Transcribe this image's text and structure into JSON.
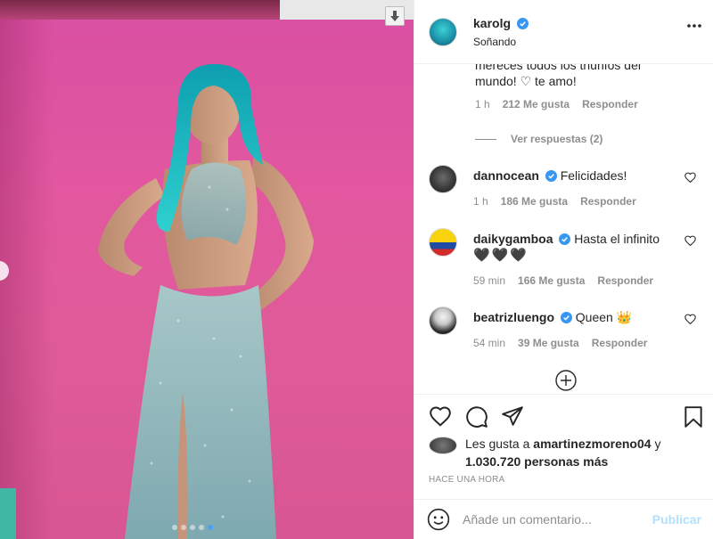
{
  "post": {
    "username": "karolg",
    "location": "Soñando"
  },
  "comments": {
    "truncated": {
      "text": "mereces todos los triunfos del mundo! ♡ te amo!",
      "time": "1 h",
      "likes": "212 Me gusta",
      "reply": "Responder"
    },
    "view_replies": "Ver respuestas (2)",
    "items": [
      {
        "username": "dannocean",
        "text": "Felicidades!",
        "time": "1 h",
        "likes": "186 Me gusta",
        "reply": "Responder"
      },
      {
        "username": "daikygamboa",
        "text": "Hasta el infinito",
        "extra": "🖤🖤🖤",
        "time": "59 min",
        "likes": "166 Me gusta",
        "reply": "Responder"
      },
      {
        "username": "beatrizluengo",
        "text": "Queen 👑",
        "time": "54 min",
        "likes": "39 Me gusta",
        "reply": "Responder"
      }
    ]
  },
  "likes": {
    "prefix": "Les gusta a",
    "user": "amartinezmoreno04",
    "conj": "y",
    "others": "1.030.720 personas más"
  },
  "timestamp": "HACE UNA HORA",
  "add_comment": {
    "placeholder": "Añade un comentario...",
    "publish": "Publicar"
  },
  "icons": {
    "download": "download-icon",
    "more": "more-options-icon",
    "like": "heart-icon",
    "comment": "comment-icon",
    "share": "share-icon",
    "save": "bookmark-icon",
    "emoji": "emoji-icon",
    "load_more": "plus-circle-icon"
  },
  "colors": {
    "verified": "#3897f0",
    "publish_disabled": "#b2dffc",
    "photo_background": "#e0579e",
    "hair": "#1fc2c9"
  },
  "carousel": {
    "count": 5,
    "active": 5
  }
}
